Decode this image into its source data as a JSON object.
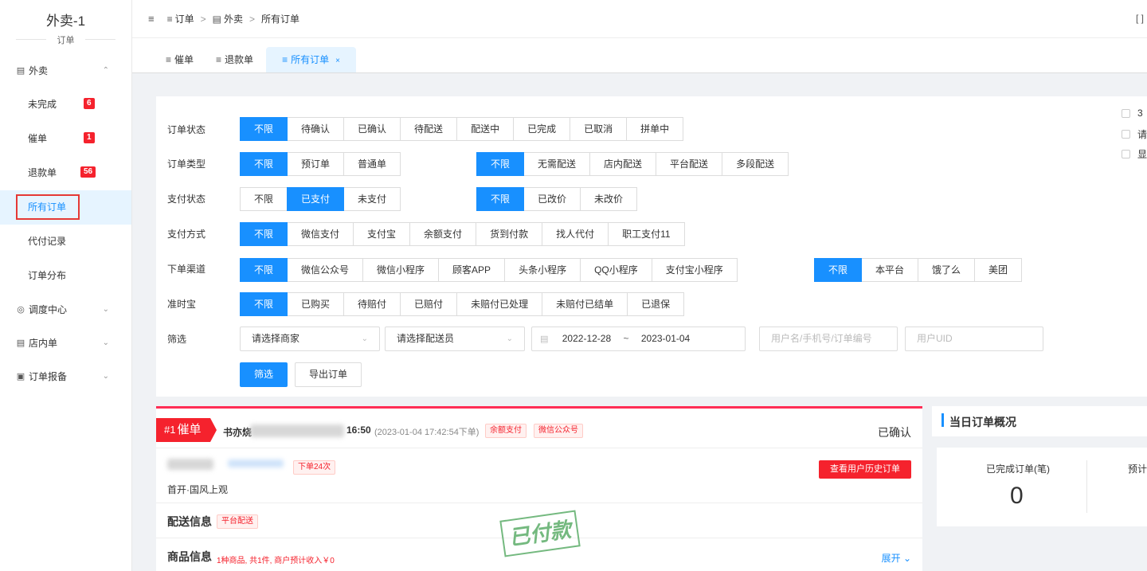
{
  "sidebar": {
    "brand_title": "外卖-1",
    "brand_sub": "订单",
    "group_waimai": "外卖",
    "items": [
      {
        "label": "未完成",
        "badge": "6"
      },
      {
        "label": "催单",
        "badge": "1"
      },
      {
        "label": "退款单",
        "badge": "56"
      },
      {
        "label": "所有订单",
        "badge": ""
      },
      {
        "label": "代付记录",
        "badge": ""
      },
      {
        "label": "订单分布",
        "badge": ""
      }
    ],
    "groups": [
      "调度中心",
      "店内单",
      "订单报备"
    ]
  },
  "header": {
    "crumbs": [
      "订单",
      "外卖",
      "所有订单"
    ]
  },
  "tabs": [
    {
      "label": "催单"
    },
    {
      "label": "退款单"
    },
    {
      "label": "所有订单",
      "close": "×"
    }
  ],
  "filters": {
    "order_status": {
      "label": "订单状态",
      "options": [
        "不限",
        "待确认",
        "已确认",
        "待配送",
        "配送中",
        "已完成",
        "已取消",
        "拼单中"
      ]
    },
    "order_type": {
      "label": "订单类型",
      "options": [
        "不限",
        "预订单",
        "普通单"
      ],
      "options2": [
        "不限",
        "无需配送",
        "店内配送",
        "平台配送",
        "多段配送"
      ]
    },
    "pay_status": {
      "label": "支付状态",
      "options": [
        "不限",
        "已支付",
        "未支付"
      ],
      "options2": [
        "不限",
        "已改价",
        "未改价"
      ]
    },
    "pay_method": {
      "label": "支付方式",
      "options": [
        "不限",
        "微信支付",
        "支付宝",
        "余额支付",
        "货到付款",
        "找人代付",
        "职工支付11"
      ]
    },
    "channel": {
      "label": "下单渠道",
      "options": [
        "不限",
        "微信公众号",
        "微信小程序",
        "顾客APP",
        "头条小程序",
        "QQ小程序",
        "支付宝小程序"
      ],
      "options2": [
        "不限",
        "本平台",
        "饿了么",
        "美团"
      ]
    },
    "on_time": {
      "label": "准时宝",
      "options": [
        "不限",
        "已购买",
        "待赔付",
        "已赔付",
        "未赔付已处理",
        "未赔付已结单",
        "已退保"
      ]
    },
    "screen": {
      "label": "筛选",
      "merchant_placeholder": "请选择商家",
      "courier_placeholder": "请选择配送员",
      "date_from": "2022-12-28",
      "date_to": "2023-01-04",
      "date_sep": "~",
      "user_placeholder": "用户名/手机号/订单编号",
      "uid_placeholder": "用户UID"
    },
    "filter_btn": "筛选",
    "export_btn": "导出订单",
    "checkboxes": [
      "3",
      "请",
      "显"
    ]
  },
  "order": {
    "rank": "#1",
    "rank_label": "催单",
    "shop": "书亦烧",
    "time": "16:50",
    "placed": "(2023-01-04 17:42:54下单)",
    "tags": [
      "余额支付",
      "微信公众号"
    ],
    "status": "已确认",
    "user_count": "下单24次",
    "address": "首开·国风上观",
    "history_btn": "查看用户历史订单",
    "delivery_title": "配送信息",
    "delivery_tag": "平台配送",
    "goods_title": "商品信息",
    "goods_note": "1种商品, 共1件, 商户预计收入￥0",
    "expand": "展开",
    "stamp": "已付款"
  },
  "summary": {
    "title": "当日订单概况",
    "completed_label": "已完成订单(笔)",
    "completed_value": "0",
    "next_label": "预计"
  }
}
